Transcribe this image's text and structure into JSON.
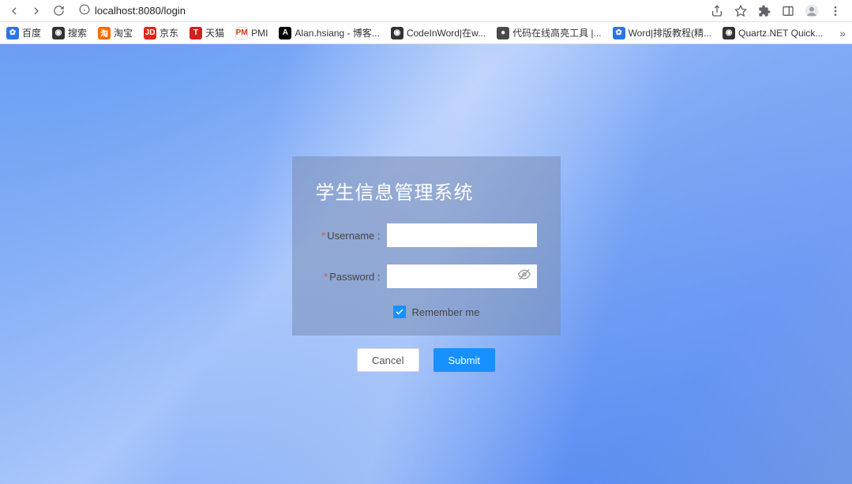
{
  "browser": {
    "url": "localhost:8080/login"
  },
  "bookmarks": [
    {
      "label": "百度",
      "favBg": "#2a73e8",
      "favText": "✿"
    },
    {
      "label": "搜索",
      "favBg": "#333",
      "favText": "◉"
    },
    {
      "label": "淘宝",
      "favBg": "#ff6a00",
      "favText": "淘"
    },
    {
      "label": "京东",
      "favBg": "#e1251b",
      "favText": "JD"
    },
    {
      "label": "天猫",
      "favBg": "#d41f1f",
      "favText": "T"
    },
    {
      "label": "PMI",
      "favBg": "#fff",
      "favText": "PM"
    },
    {
      "label": "Alan.hsiang - 博客...",
      "favBg": "#000",
      "favText": "A"
    },
    {
      "label": "CodeInWord|在w...",
      "favBg": "#333",
      "favText": "◉"
    },
    {
      "label": "代码在线高亮工具 |...",
      "favBg": "#4a4a4a",
      "favText": "●"
    },
    {
      "label": "Word|排版教程(精...",
      "favBg": "#2a73e8",
      "favText": "✿"
    },
    {
      "label": "Quartz.NET Quick...",
      "favBg": "#333",
      "favText": "◉"
    }
  ],
  "login": {
    "title": "学生信息管理系统",
    "usernameLabel": "Username :",
    "passwordLabel": "Password :",
    "rememberLabel": "Remember me",
    "rememberChecked": true,
    "cancel": "Cancel",
    "submit": "Submit"
  }
}
